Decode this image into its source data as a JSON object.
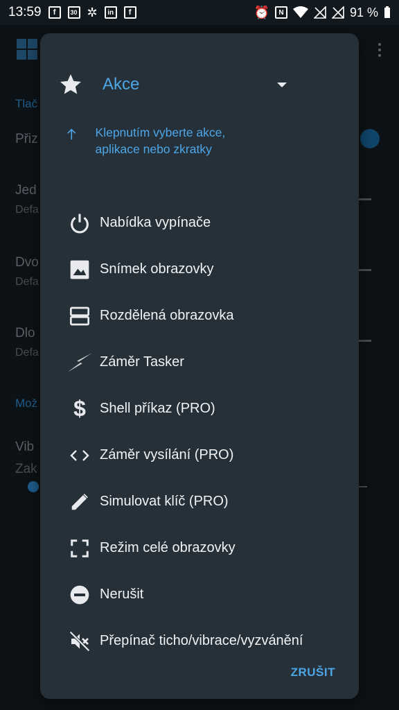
{
  "status_bar": {
    "time": "13:59",
    "battery": "91 %",
    "left_icons": [
      "facebook-icon",
      "calendar-icon",
      "slack-icon",
      "linkedin-icon",
      "facebook-icon"
    ],
    "calendar_day": "30",
    "right_icons": [
      "alarm-icon",
      "nfc-icon",
      "wifi-icon",
      "signal-off-icon",
      "signal-off-icon",
      "battery-icon"
    ]
  },
  "background": {
    "section1": "Tlač",
    "row1": "Přiz",
    "row2_title": "Jed",
    "row2_sub": "Defa",
    "row3_title": "Dvo",
    "row3_sub": "Defa",
    "row4_title": "Dlo",
    "row4_sub": "Defa",
    "section2": "Mož",
    "row5_title": "Vib",
    "row5_sub": "Zak"
  },
  "dialog": {
    "header_label": "Akce",
    "hint": "Klepnutím vyberte akce, aplikace nebo zkratky",
    "items": [
      {
        "label": "Nabídka vypínače",
        "icon": "power-icon"
      },
      {
        "label": "Snímek obrazovky",
        "icon": "image-icon"
      },
      {
        "label": "Rozdělená obrazovka",
        "icon": "split-screen-icon"
      },
      {
        "label": "Záměr Tasker",
        "icon": "tasker-bolt-icon"
      },
      {
        "label": "Shell příkaz (PRO)",
        "icon": "dollar-icon"
      },
      {
        "label": "Záměr vysílání (PRO)",
        "icon": "code-icon"
      },
      {
        "label": "Simulovat klíč (PRO)",
        "icon": "pencil-icon"
      },
      {
        "label": "Režim celé obrazovky",
        "icon": "fullscreen-icon"
      },
      {
        "label": "Nerušit",
        "icon": "do-not-disturb-icon"
      },
      {
        "label": "Přepínač ticho/vibrace/vyzvánění",
        "icon": "mute-icon"
      }
    ],
    "cancel_label": "ZRUŠIT"
  },
  "colors": {
    "accent": "#4ea6e6",
    "dialog_bg": "#253039",
    "background": "#151c22"
  }
}
